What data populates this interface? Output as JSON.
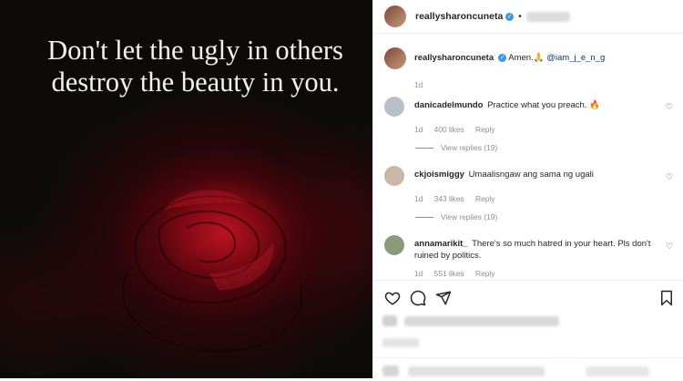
{
  "photo": {
    "quote": "Don't let the ugly in others destroy the beauty in you."
  },
  "header": {
    "username": "reallysharoncuneta",
    "separator": "•"
  },
  "caption": {
    "username": "reallysharoncuneta",
    "text": "Amen.",
    "emoji": "🙏",
    "mention": "@iam_j_e_n_g",
    "time": "1d"
  },
  "comments": [
    {
      "username": "danicadelmundo",
      "text": "Practice what you preach.",
      "emoji": "🔥",
      "time": "1d",
      "likes": "400 likes",
      "reply": "Reply",
      "view_replies": "View replies (19)",
      "avatar_color": "#b7c1c9"
    },
    {
      "username": "ckjoismiggy",
      "text": "Umaalisngaw ang sama ng ugali",
      "emoji": "",
      "time": "1d",
      "likes": "343 likes",
      "reply": "Reply",
      "view_replies": "View replies (19)",
      "avatar_color": "#c9b7a8"
    },
    {
      "username": "annamarikit_",
      "text": "There's so much hatred in your heart. Pls don't ruined by politics.",
      "emoji": "",
      "time": "1d",
      "likes": "551 likes",
      "reply": "Reply",
      "view_replies": "",
      "avatar_color": "#8a9a7a"
    }
  ],
  "icons": {
    "like": "heart-icon",
    "comment": "comment-icon",
    "share": "share-icon",
    "save": "bookmark-icon"
  },
  "colors": {
    "verified": "#3897f0",
    "meta_gray": "#8e8e8e",
    "text": "#262626"
  }
}
